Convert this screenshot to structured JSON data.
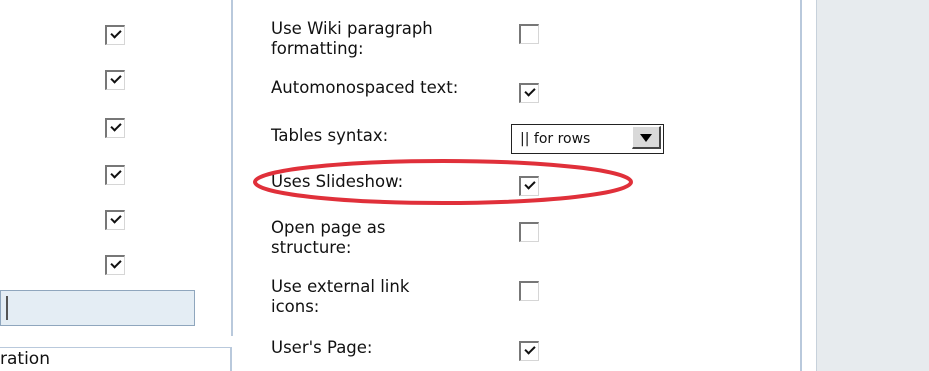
{
  "left_panel": {
    "checkboxes": [
      true,
      true,
      true,
      true,
      true,
      true
    ],
    "footer_text": "ration"
  },
  "settings": {
    "rows": [
      {
        "label": "Use Wiki paragraph formatting:",
        "checked": false
      },
      {
        "label": "Automonospaced text:",
        "checked": true
      },
      {
        "label": "Tables syntax:",
        "control": "select",
        "value": "|| for rows"
      },
      {
        "label": "Uses Slideshow:",
        "checked": true,
        "highlighted": true
      },
      {
        "label": "Open page as structure:",
        "checked": false
      },
      {
        "label": "Use external link icons:",
        "checked": false
      },
      {
        "label": "User's Page:",
        "checked": true
      }
    ]
  },
  "colors": {
    "highlight_ellipse": "#e0303a",
    "panel_border": "#b9c9dc",
    "right_panel_bg": "#e7ebee"
  }
}
